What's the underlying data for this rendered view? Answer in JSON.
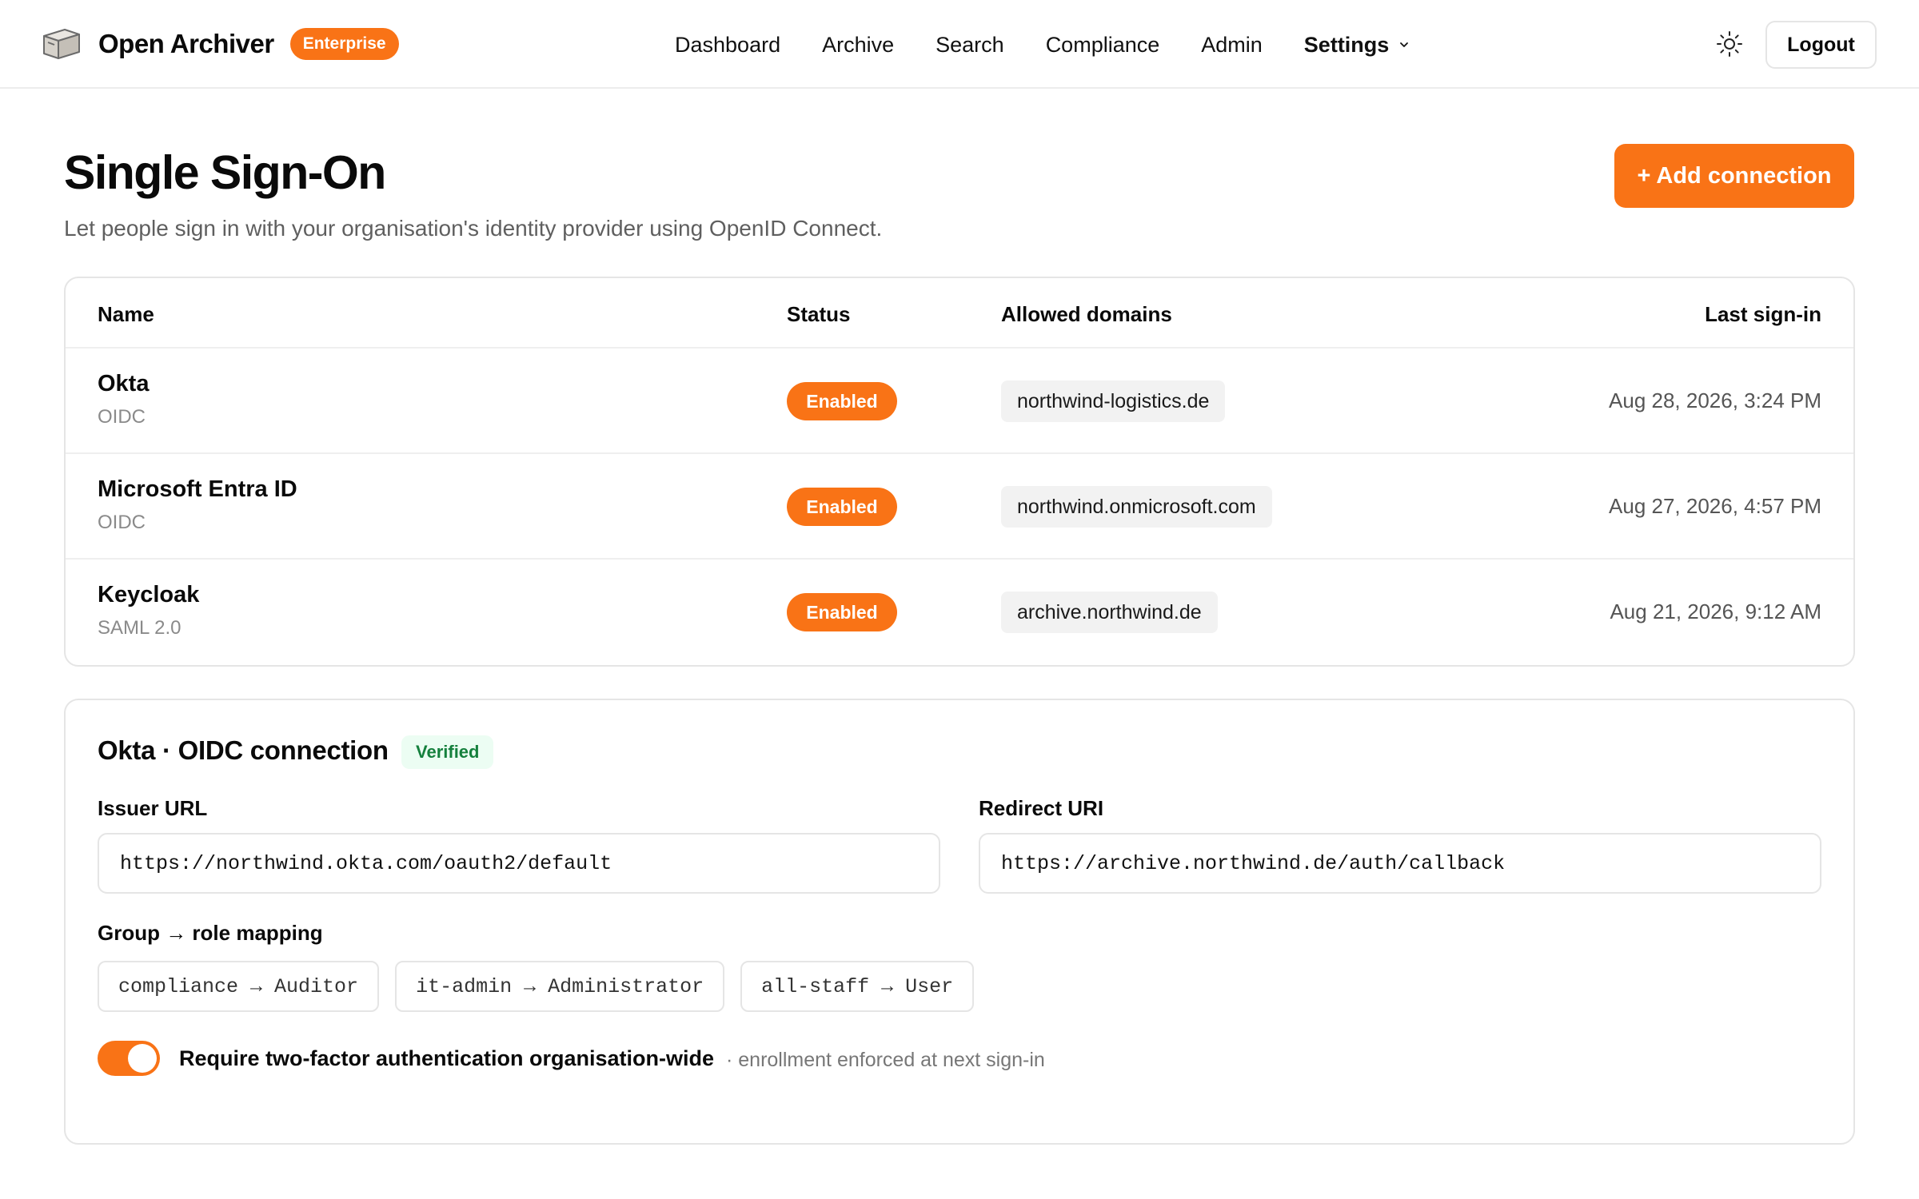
{
  "header": {
    "brand": "Open Archiver",
    "edition_badge": "Enterprise",
    "nav": [
      "Dashboard",
      "Archive",
      "Search",
      "Compliance",
      "Admin"
    ],
    "settings_label": "Settings",
    "logout_label": "Logout"
  },
  "page": {
    "title": "Single Sign-On",
    "subtitle": "Let people sign in with your organisation's identity provider using OpenID Connect.",
    "add_button": "+ Add connection"
  },
  "table": {
    "columns": {
      "name": "Name",
      "status": "Status",
      "domains": "Allowed domains",
      "last_signin": "Last sign-in"
    },
    "rows": [
      {
        "name": "Okta",
        "type": "OIDC",
        "status": "Enabled",
        "domain": "northwind-logistics.de",
        "last_signin": "Aug 28, 2026, 3:24 PM"
      },
      {
        "name": "Microsoft Entra ID",
        "type": "OIDC",
        "status": "Enabled",
        "domain": "northwind.onmicrosoft.com",
        "last_signin": "Aug 27, 2026, 4:57 PM"
      },
      {
        "name": "Keycloak",
        "type": "SAML 2.0",
        "status": "Enabled",
        "domain": "archive.northwind.de",
        "last_signin": "Aug 21, 2026, 9:12 AM"
      }
    ]
  },
  "detail": {
    "title": "Okta · OIDC connection",
    "verified_badge": "Verified",
    "issuer_label": "Issuer URL",
    "issuer_value": "https://northwind.okta.com/oauth2/default",
    "redirect_label": "Redirect URI",
    "redirect_value": "https://archive.northwind.de/auth/callback",
    "mapping_label": "Group → role mapping",
    "mappings": [
      "compliance → Auditor",
      "it-admin → Administrator",
      "all-staff → User"
    ],
    "two_factor_label": "Require two-factor authentication organisation-wide",
    "two_factor_note": "· enrollment enforced at next sign-in",
    "two_factor_enabled": true
  },
  "colors": {
    "accent": "#f97316",
    "verified_bg": "#ecfdf3",
    "verified_text": "#15803d"
  },
  "icons": {
    "logo": "archive-box-icon",
    "theme": "sun-icon",
    "settings_caret": "chevron-down-icon"
  }
}
